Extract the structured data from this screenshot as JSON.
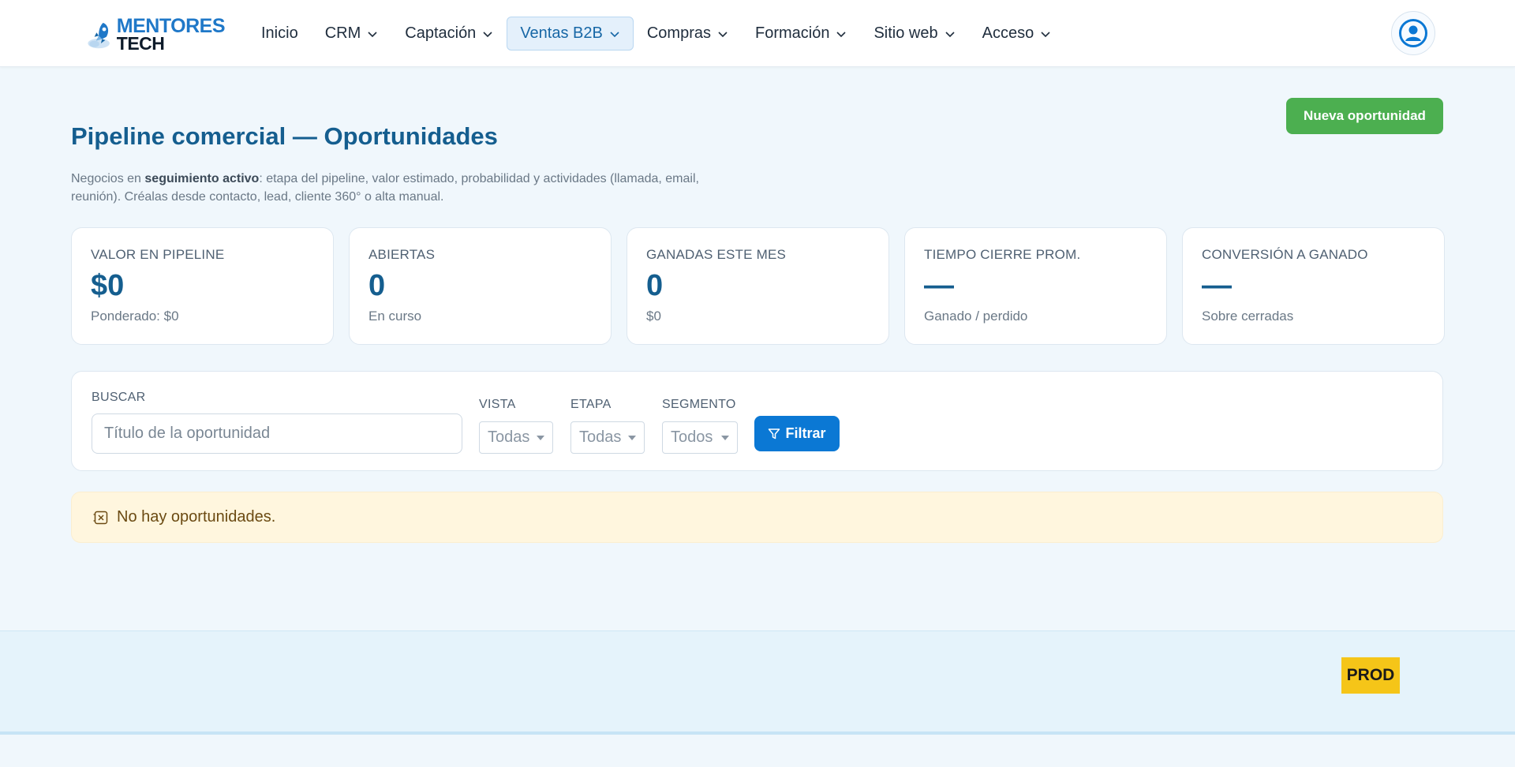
{
  "brand": {
    "line1": "MENTORES",
    "line2": "TECH"
  },
  "nav": {
    "items": [
      {
        "label": "Inicio",
        "has_dropdown": false
      },
      {
        "label": "CRM",
        "has_dropdown": true
      },
      {
        "label": "Captación",
        "has_dropdown": true
      },
      {
        "label": "Ventas B2B",
        "has_dropdown": true,
        "active": true
      },
      {
        "label": "Compras",
        "has_dropdown": true
      },
      {
        "label": "Formación",
        "has_dropdown": true
      },
      {
        "label": "Sitio web",
        "has_dropdown": true
      },
      {
        "label": "Acceso",
        "has_dropdown": true
      }
    ]
  },
  "header": {
    "new_button": "Nueva oportunidad",
    "title": "Pipeline comercial — Oportunidades",
    "desc_prefix": "Negocios en ",
    "desc_bold": "seguimiento activo",
    "desc_suffix": ": etapa del pipeline, valor estimado, probabilidad y actividades (llamada, email, reunión). Créalas desde contacto, lead, cliente 360° o alta manual."
  },
  "stats": [
    {
      "label": "VALOR EN PIPELINE",
      "value": "$0",
      "sub": "Ponderado: $0"
    },
    {
      "label": "ABIERTAS",
      "value": "0",
      "sub": "En curso"
    },
    {
      "label": "GANADAS ESTE MES",
      "value": "0",
      "sub": "$0"
    },
    {
      "label": "TIEMPO CIERRE PROM.",
      "value": "—",
      "sub": "Ganado / perdido"
    },
    {
      "label": "CONVERSIÓN A GANADO",
      "value": "—",
      "sub": "Sobre cerradas"
    }
  ],
  "filters": {
    "search_label": "BUSCAR",
    "search_placeholder": "Título de la oportunidad",
    "vista_label": "VISTA",
    "vista_value": "Todas",
    "etapa_label": "ETAPA",
    "etapa_value": "Todas",
    "segmento_label": "SEGMENTO",
    "segmento_value": "Todos",
    "filter_button": "Filtrar"
  },
  "empty_message": "No hay oportunidades.",
  "footer": {
    "env_badge": "PROD"
  },
  "colors": {
    "primary": "#155e8f",
    "accent_blue": "#0b78d4",
    "success": "#4caf50",
    "warning_bg": "#fff6de",
    "badge": "#f5c518"
  }
}
